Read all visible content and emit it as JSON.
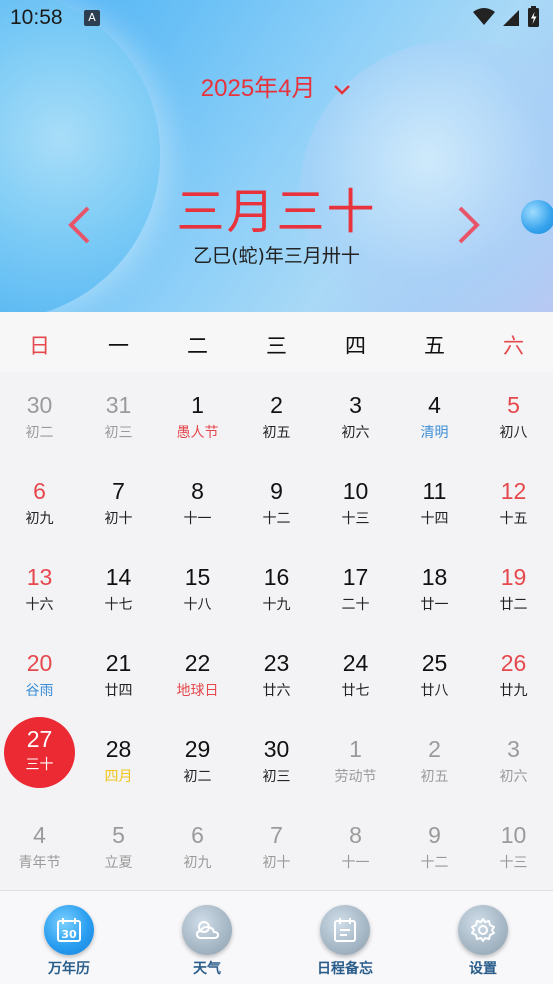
{
  "status_bar": {
    "time": "10:58",
    "notif_icon": "A"
  },
  "header": {
    "month_label": "2025年4月",
    "lunar_big": "三月三十",
    "ganzhi": "乙巳(蛇)年三月卅十"
  },
  "weekdays": [
    "日",
    "一",
    "二",
    "三",
    "四",
    "五",
    "六"
  ],
  "days": [
    {
      "d": "30",
      "l": "初二",
      "m": "other"
    },
    {
      "d": "31",
      "l": "初三",
      "m": "other"
    },
    {
      "d": "1",
      "l": "愚人节",
      "m": "cur",
      "lc": "red"
    },
    {
      "d": "2",
      "l": "初五",
      "m": "cur"
    },
    {
      "d": "3",
      "l": "初六",
      "m": "cur"
    },
    {
      "d": "4",
      "l": "清明",
      "m": "cur",
      "lc": "blue"
    },
    {
      "d": "5",
      "l": "初八",
      "m": "cur"
    },
    {
      "d": "6",
      "l": "初九",
      "m": "cur"
    },
    {
      "d": "7",
      "l": "初十",
      "m": "cur"
    },
    {
      "d": "8",
      "l": "十一",
      "m": "cur"
    },
    {
      "d": "9",
      "l": "十二",
      "m": "cur"
    },
    {
      "d": "10",
      "l": "十三",
      "m": "cur"
    },
    {
      "d": "11",
      "l": "十四",
      "m": "cur"
    },
    {
      "d": "12",
      "l": "十五",
      "m": "cur"
    },
    {
      "d": "13",
      "l": "十六",
      "m": "cur"
    },
    {
      "d": "14",
      "l": "十七",
      "m": "cur"
    },
    {
      "d": "15",
      "l": "十八",
      "m": "cur"
    },
    {
      "d": "16",
      "l": "十九",
      "m": "cur"
    },
    {
      "d": "17",
      "l": "二十",
      "m": "cur"
    },
    {
      "d": "18",
      "l": "廿一",
      "m": "cur"
    },
    {
      "d": "19",
      "l": "廿二",
      "m": "cur"
    },
    {
      "d": "20",
      "l": "谷雨",
      "m": "cur",
      "lc": "blue"
    },
    {
      "d": "21",
      "l": "廿四",
      "m": "cur"
    },
    {
      "d": "22",
      "l": "地球日",
      "m": "cur",
      "lc": "red"
    },
    {
      "d": "23",
      "l": "廿六",
      "m": "cur"
    },
    {
      "d": "24",
      "l": "廿七",
      "m": "cur"
    },
    {
      "d": "25",
      "l": "廿八",
      "m": "cur"
    },
    {
      "d": "26",
      "l": "廿九",
      "m": "cur"
    },
    {
      "d": "27",
      "l": "三十",
      "m": "cur",
      "today": true
    },
    {
      "d": "28",
      "l": "四月",
      "m": "cur",
      "lc": "yellow"
    },
    {
      "d": "29",
      "l": "初二",
      "m": "cur"
    },
    {
      "d": "30",
      "l": "初三",
      "m": "cur"
    },
    {
      "d": "1",
      "l": "劳动节",
      "m": "other"
    },
    {
      "d": "2",
      "l": "初五",
      "m": "other"
    },
    {
      "d": "3",
      "l": "初六",
      "m": "other"
    },
    {
      "d": "4",
      "l": "青年节",
      "m": "other"
    },
    {
      "d": "5",
      "l": "立夏",
      "m": "other"
    },
    {
      "d": "6",
      "l": "初九",
      "m": "other"
    },
    {
      "d": "7",
      "l": "初十",
      "m": "other"
    },
    {
      "d": "8",
      "l": "十一",
      "m": "other"
    },
    {
      "d": "9",
      "l": "十二",
      "m": "other"
    },
    {
      "d": "10",
      "l": "十三",
      "m": "other"
    }
  ],
  "tabs": [
    {
      "label": "万年历",
      "icon": "calendar-30-icon",
      "active": true
    },
    {
      "label": "天气",
      "icon": "weather-icon",
      "active": false
    },
    {
      "label": "日程备忘",
      "icon": "schedule-icon",
      "active": false
    },
    {
      "label": "设置",
      "icon": "gear-icon",
      "active": false
    }
  ],
  "colors": {
    "accent_red": "#e8323c",
    "weekend_red": "#e5484d",
    "term_blue": "#3d8fd8",
    "festival_red": "#e5484d",
    "month_yellow": "#f0c419",
    "other_gray": "#9a9a9a",
    "tab_label": "#2a5d8a"
  }
}
